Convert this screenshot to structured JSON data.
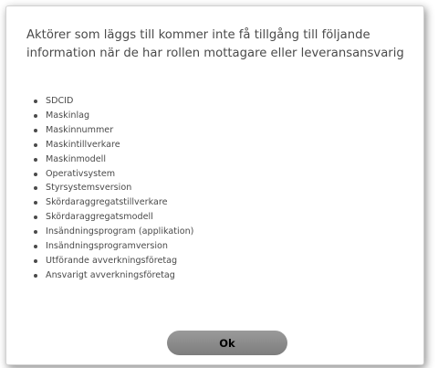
{
  "dialog": {
    "header_line1": "Aktörer som läggs till kommer inte få tillgång till följande",
    "header_line2": "information när de har rollen mottagare eller leveransansvarig",
    "items": [
      "SDCID",
      "Maskinlag",
      "Maskinnummer",
      "Maskintillverkare",
      "Maskinmodell",
      "Operativsystem",
      "Styrsystemsversion",
      "Skördaraggregatstillverkare",
      "Skördaraggregatsmodell",
      "Insändningsprogram (applikation)",
      "Insändningsprogramversion",
      "Utförande avverkningsföretag",
      "Ansvarigt avverkningsföretag"
    ],
    "ok_label": "Ok"
  }
}
